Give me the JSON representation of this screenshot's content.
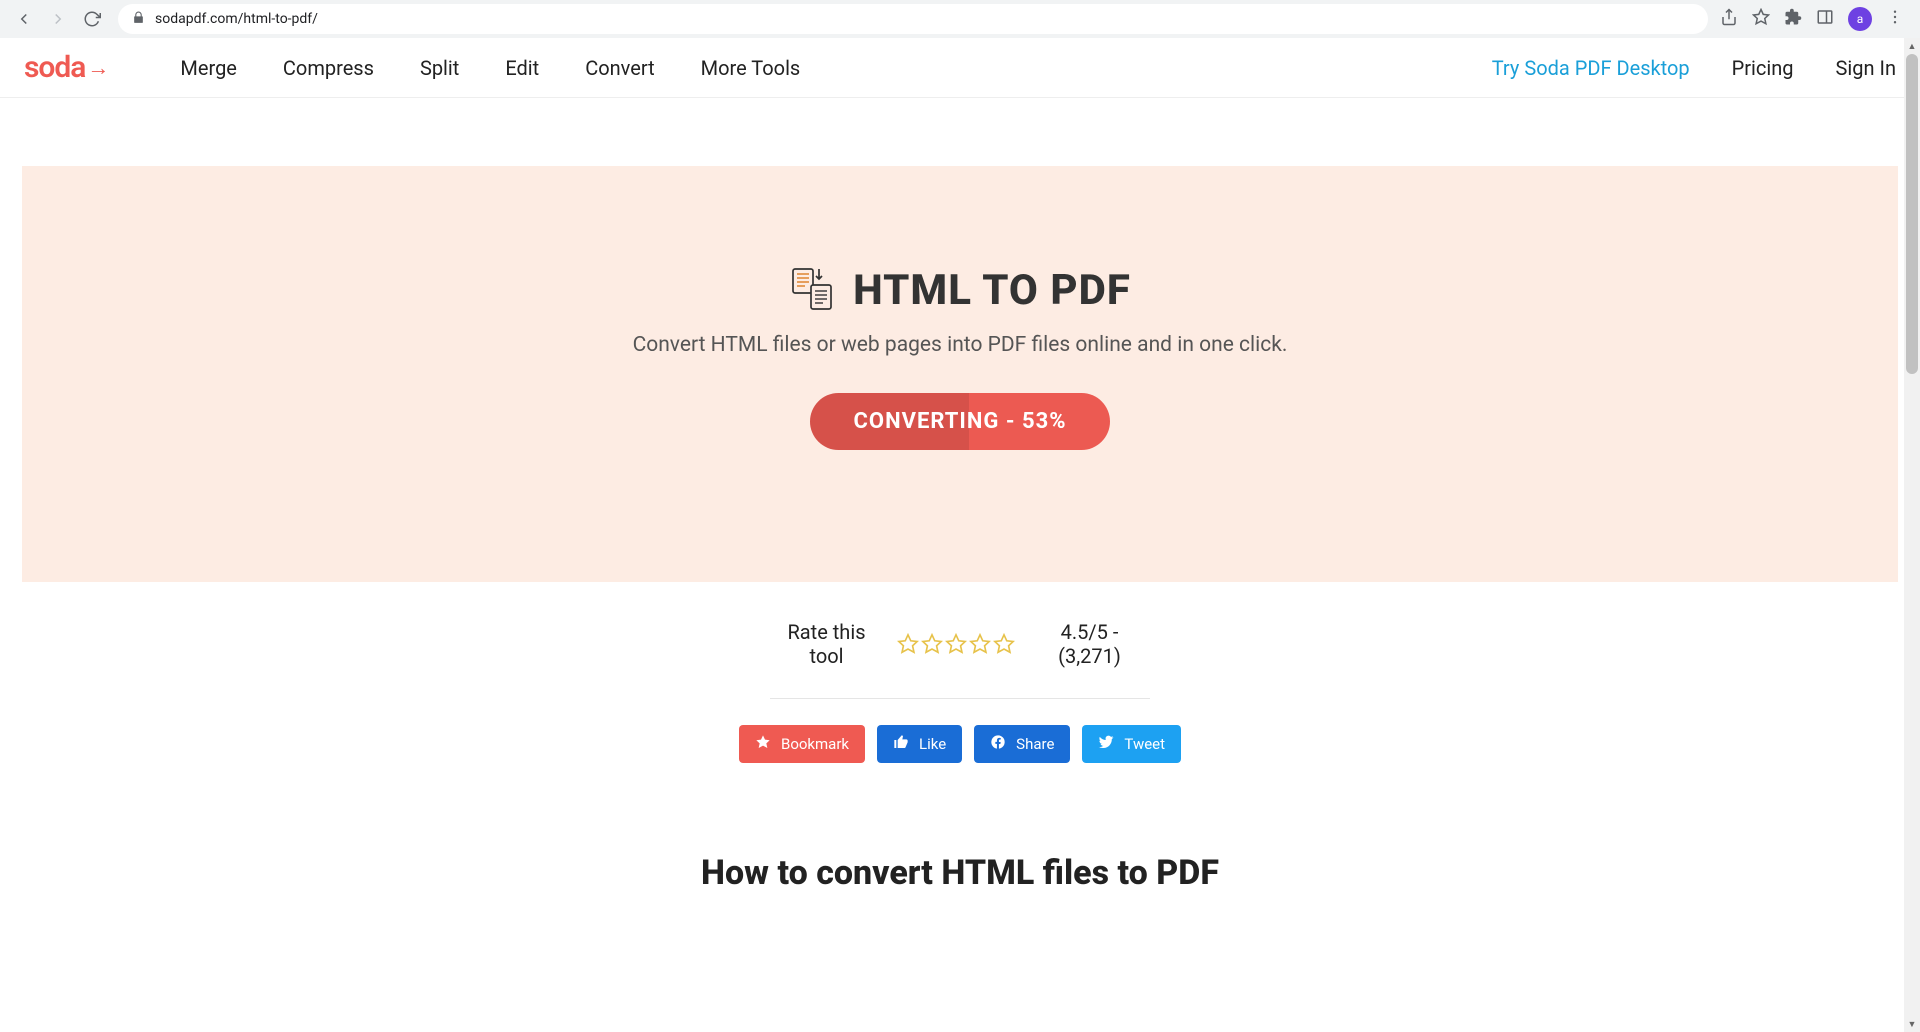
{
  "browser": {
    "url": "sodapdf.com/html-to-pdf/",
    "avatar_letter": "a"
  },
  "nav": {
    "logo_text": "soda",
    "items": [
      "Merge",
      "Compress",
      "Split",
      "Edit",
      "Convert",
      "More Tools"
    ],
    "cta": "Try Soda PDF Desktop",
    "right": [
      "Pricing",
      "Sign In"
    ]
  },
  "hero": {
    "title": "HTML TO PDF",
    "subtitle": "Convert HTML files or web pages into PDF files online and in one click.",
    "button_label": "CONVERTING - 53%",
    "progress_pct": 53
  },
  "rating": {
    "label": "Rate this tool",
    "score_text": "4.5/5 - (3,271)"
  },
  "share": {
    "bookmark": "Bookmark",
    "like": "Like",
    "share": "Share",
    "tweet": "Tweet"
  },
  "howto_title": "How to convert HTML files to PDF"
}
